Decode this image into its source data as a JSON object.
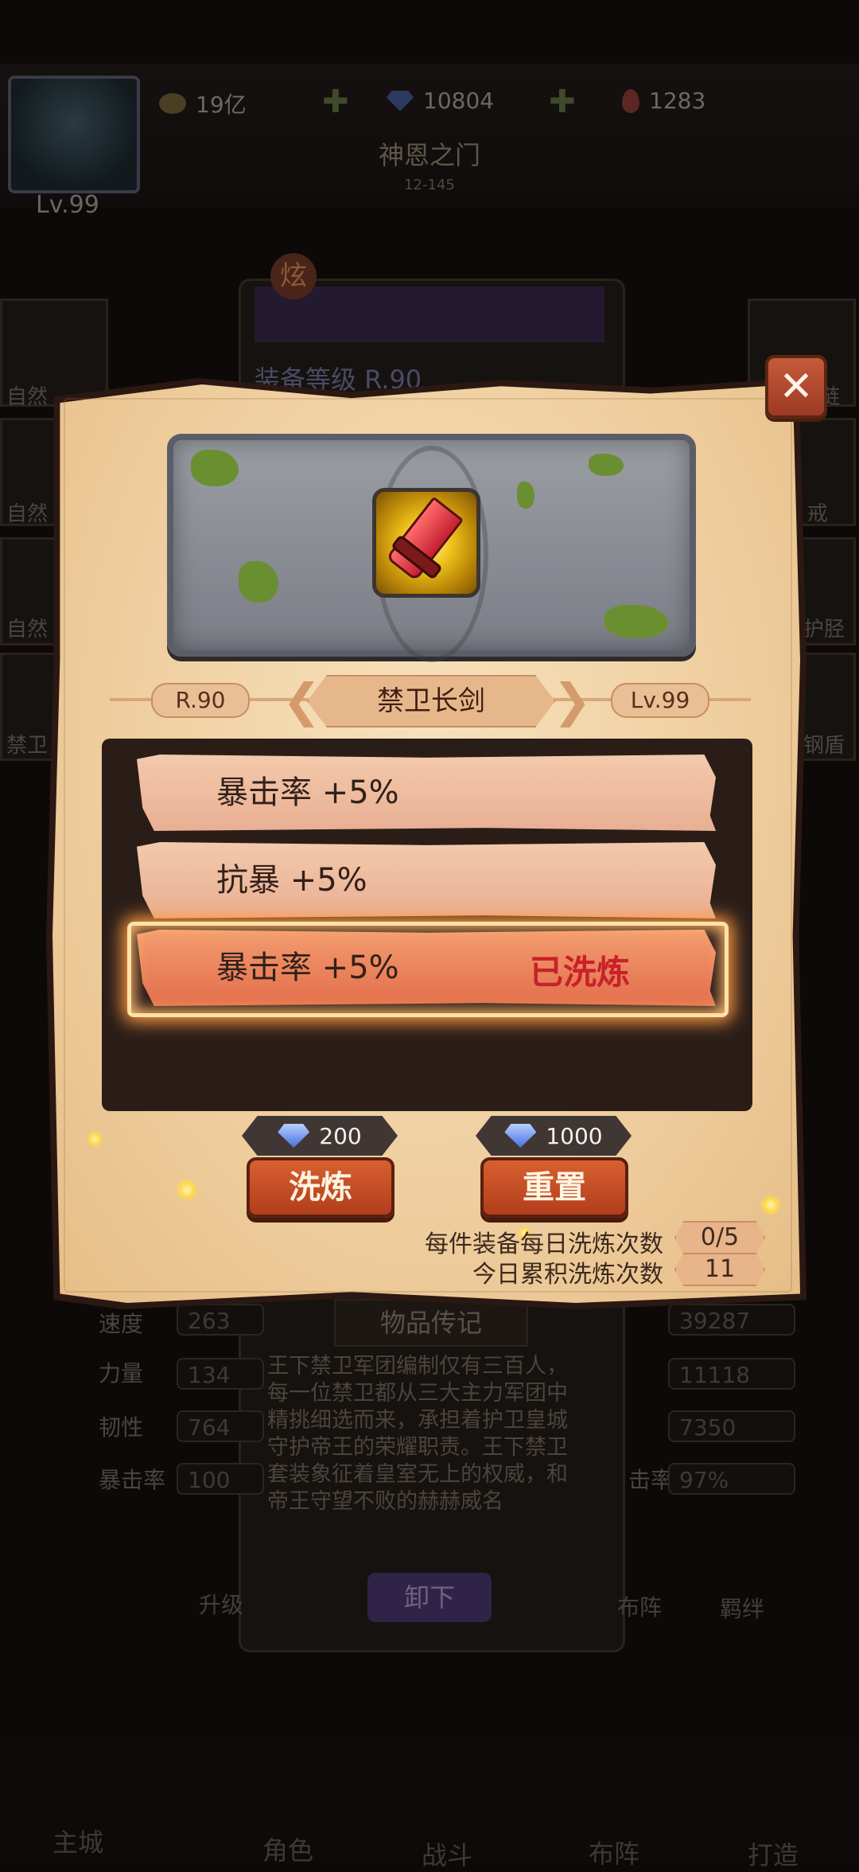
{
  "header": {
    "resources": [
      "19亿",
      "10804",
      "1283"
    ],
    "player_level": "Lv.99",
    "stage_title": "神恩之门",
    "stage_sub": "12-145"
  },
  "background": {
    "hero_title_badge": "炫",
    "equip_level_text": "装备等级  R.90",
    "side_slots": [
      "自然",
      "自然",
      "自然",
      "禁卫"
    ],
    "side_right": [
      "链",
      "戒",
      "护胫",
      "钢盾"
    ],
    "stats_left": [
      {
        "label": "速度",
        "value": "263"
      },
      {
        "label": "力量",
        "value": "134"
      },
      {
        "label": "韧性",
        "value": "764"
      },
      {
        "label": "暴击率",
        "value": "100"
      }
    ],
    "stats_right": [
      {
        "label": "",
        "value": "39287"
      },
      {
        "label": "",
        "value": "11118"
      },
      {
        "label": "",
        "value": "7350"
      },
      {
        "label": "击率",
        "value": "97%"
      }
    ],
    "lore_title": "物品传记",
    "lore_text": "王下禁卫军团编制仅有三百人，每一位禁卫都从三大主力军团中精挑细选而来，承担着护卫皇城守护帝王的荣耀职责。王下禁卫套装象征着皇室无上的权威，和帝王守望不败的赫赫威名",
    "unequip": "卸下",
    "func_left": "升级",
    "func_mid": "布阵",
    "func_right": "羁绊",
    "nav": [
      "主城",
      "角色",
      "战斗",
      "布阵",
      "打造"
    ]
  },
  "modal": {
    "rank": "R.90",
    "item_name": "禁卫长剑",
    "level": "Lv.99",
    "attributes": [
      {
        "text": "暴击率 +5%",
        "status": ""
      },
      {
        "text": "抗暴 +5%",
        "status": ""
      },
      {
        "text": "暴击率 +5%",
        "status": "已洗炼"
      }
    ],
    "refine": {
      "cost": "200",
      "label": "洗炼"
    },
    "reset": {
      "cost": "1000",
      "label": "重置"
    },
    "daily_label": "每件装备每日洗炼次数",
    "daily_value": "0/5",
    "total_label": "今日累积洗炼次数",
    "total_value": "11"
  },
  "colors": {
    "parchment": "#efcfa0",
    "button": "#c44d26",
    "refined_text": "#c8212a",
    "panel_dark": "#2a1d18"
  }
}
